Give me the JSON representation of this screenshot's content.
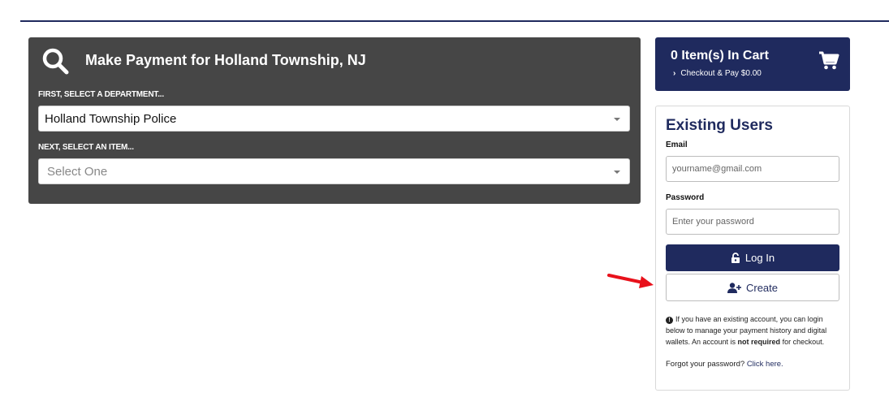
{
  "payment": {
    "title": "Make Payment for Holland Township, NJ",
    "step1_label": "FIRST, SELECT A DEPARTMENT...",
    "department_value": "Holland Township Police",
    "step2_label": "NEXT, SELECT AN ITEM...",
    "item_value": "Select One"
  },
  "cart": {
    "count_label": "0 Item(s) In Cart",
    "checkout_label": "Checkout & Pay $0.00"
  },
  "login": {
    "title": "Existing Users",
    "email_label": "Email",
    "email_placeholder": "yourname@gmail.com",
    "password_label": "Password",
    "password_placeholder": "Enter your password",
    "login_button": "Log In",
    "create_button": "Create",
    "info_part1": "If you have an existing account, you can login below to manage your payment history and digital wallets. An account is ",
    "info_bold": "not required",
    "info_part2": " for checkout.",
    "forgot_text": "Forgot your password?",
    "forgot_link": "Click here."
  },
  "colors": {
    "navy": "#1f2a5e",
    "panel_dark": "#464646",
    "annotation_red": "#e8111b"
  },
  "icons": [
    "search-icon",
    "cart-icon",
    "chevron-right-icon",
    "lock-icon",
    "user-plus-icon",
    "info-icon",
    "red-arrow-annotation"
  ]
}
